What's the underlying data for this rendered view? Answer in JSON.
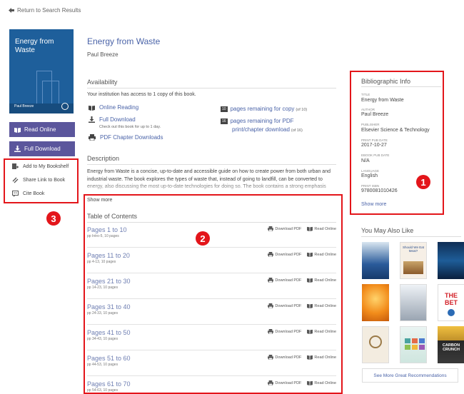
{
  "nav": {
    "back_label": "Return to Search Results"
  },
  "book": {
    "title": "Energy from Waste",
    "author": "Paul Breeze",
    "cover_title_line1": "Energy from",
    "cover_title_line2": "Waste",
    "cover_author": "Paul Breeze"
  },
  "buttons": {
    "read_online": "Read Online",
    "full_download": "Full Download"
  },
  "actions": {
    "add_bookshelf": "Add to My Bookshelf",
    "share_link": "Share Link to Book",
    "cite_book": "Cite Book"
  },
  "availability": {
    "heading": "Availability",
    "access_text": "Your institution has access to 1 copy of this book.",
    "online_reading": "Online Reading",
    "full_download": "Full Download",
    "checkout_note": "Check out this book for up to 1 day.",
    "pdf_chapter": "PDF Chapter Downloads",
    "copy_count": "10",
    "copy_text": "pages remaining for copy",
    "copy_of": "(of 10)",
    "pdf_count": "16",
    "pdf_text_1": "pages remaining for PDF",
    "pdf_text_2": "print/chapter download",
    "pdf_of": "(of 16)"
  },
  "description": {
    "heading": "Description",
    "text": "Energy from Waste is a concise, up-to-date and accessible guide on how to create power from both urban and industrial waste. The book explores the types of waste that, instead of going to landfill, can be converted to energy, also discussing the most up-to-date technologies for doing so. The book contains a strong emphasis",
    "show_more": "Show more"
  },
  "toc": {
    "heading": "Table of Contents",
    "download_label": "Download PDF",
    "read_label": "Read Online",
    "rows": [
      {
        "title": "Pages 1 to 10",
        "sub": "pp Intro-5, 10 pages"
      },
      {
        "title": "Pages 11 to 20",
        "sub": "pp 4-13, 10 pages"
      },
      {
        "title": "Pages 21 to 30",
        "sub": "pp 14-23, 10 pages"
      },
      {
        "title": "Pages 31 to 40",
        "sub": "pp 24-33, 10 pages"
      },
      {
        "title": "Pages 41 to 50",
        "sub": "pp 34-43, 10 pages"
      },
      {
        "title": "Pages 51 to 60",
        "sub": "pp 44-53, 10 pages"
      },
      {
        "title": "Pages 61 to 70",
        "sub": "pp 54-63, 10 pages"
      }
    ]
  },
  "bib": {
    "heading": "Bibliographic Info",
    "title_label": "TITLE",
    "title_val": "Energy from Waste",
    "author_label": "AUTHOR",
    "author_val": "Paul Breeze",
    "publisher_label": "PUBLISHER",
    "publisher_val": "Elsevier Science & Technology",
    "print_date_label": "PRINT PUB DATE",
    "print_date_val": "2017-10-27",
    "ebook_date_label": "EBOOK PUB DATE",
    "ebook_date_val": "N/A",
    "language_label": "LANGUAGE",
    "language_val": "English",
    "isbn_label": "PRINT ISBN",
    "isbn_val": "9780081010426",
    "show_more": "Show more"
  },
  "recs": {
    "heading": "You May Also Like",
    "see_more": "See More Great Recommendations",
    "thumb1_text": "Should We Eat Meat?",
    "thumb2_text": "THE BET",
    "thumb3_text": "CARBON CRUNCH"
  },
  "callouts": {
    "one": "1",
    "two": "2",
    "three": "3"
  },
  "colors": {
    "accent_red": "#e3151a",
    "button_purple": "#5b569c",
    "link_blue": "#4a63a8"
  }
}
